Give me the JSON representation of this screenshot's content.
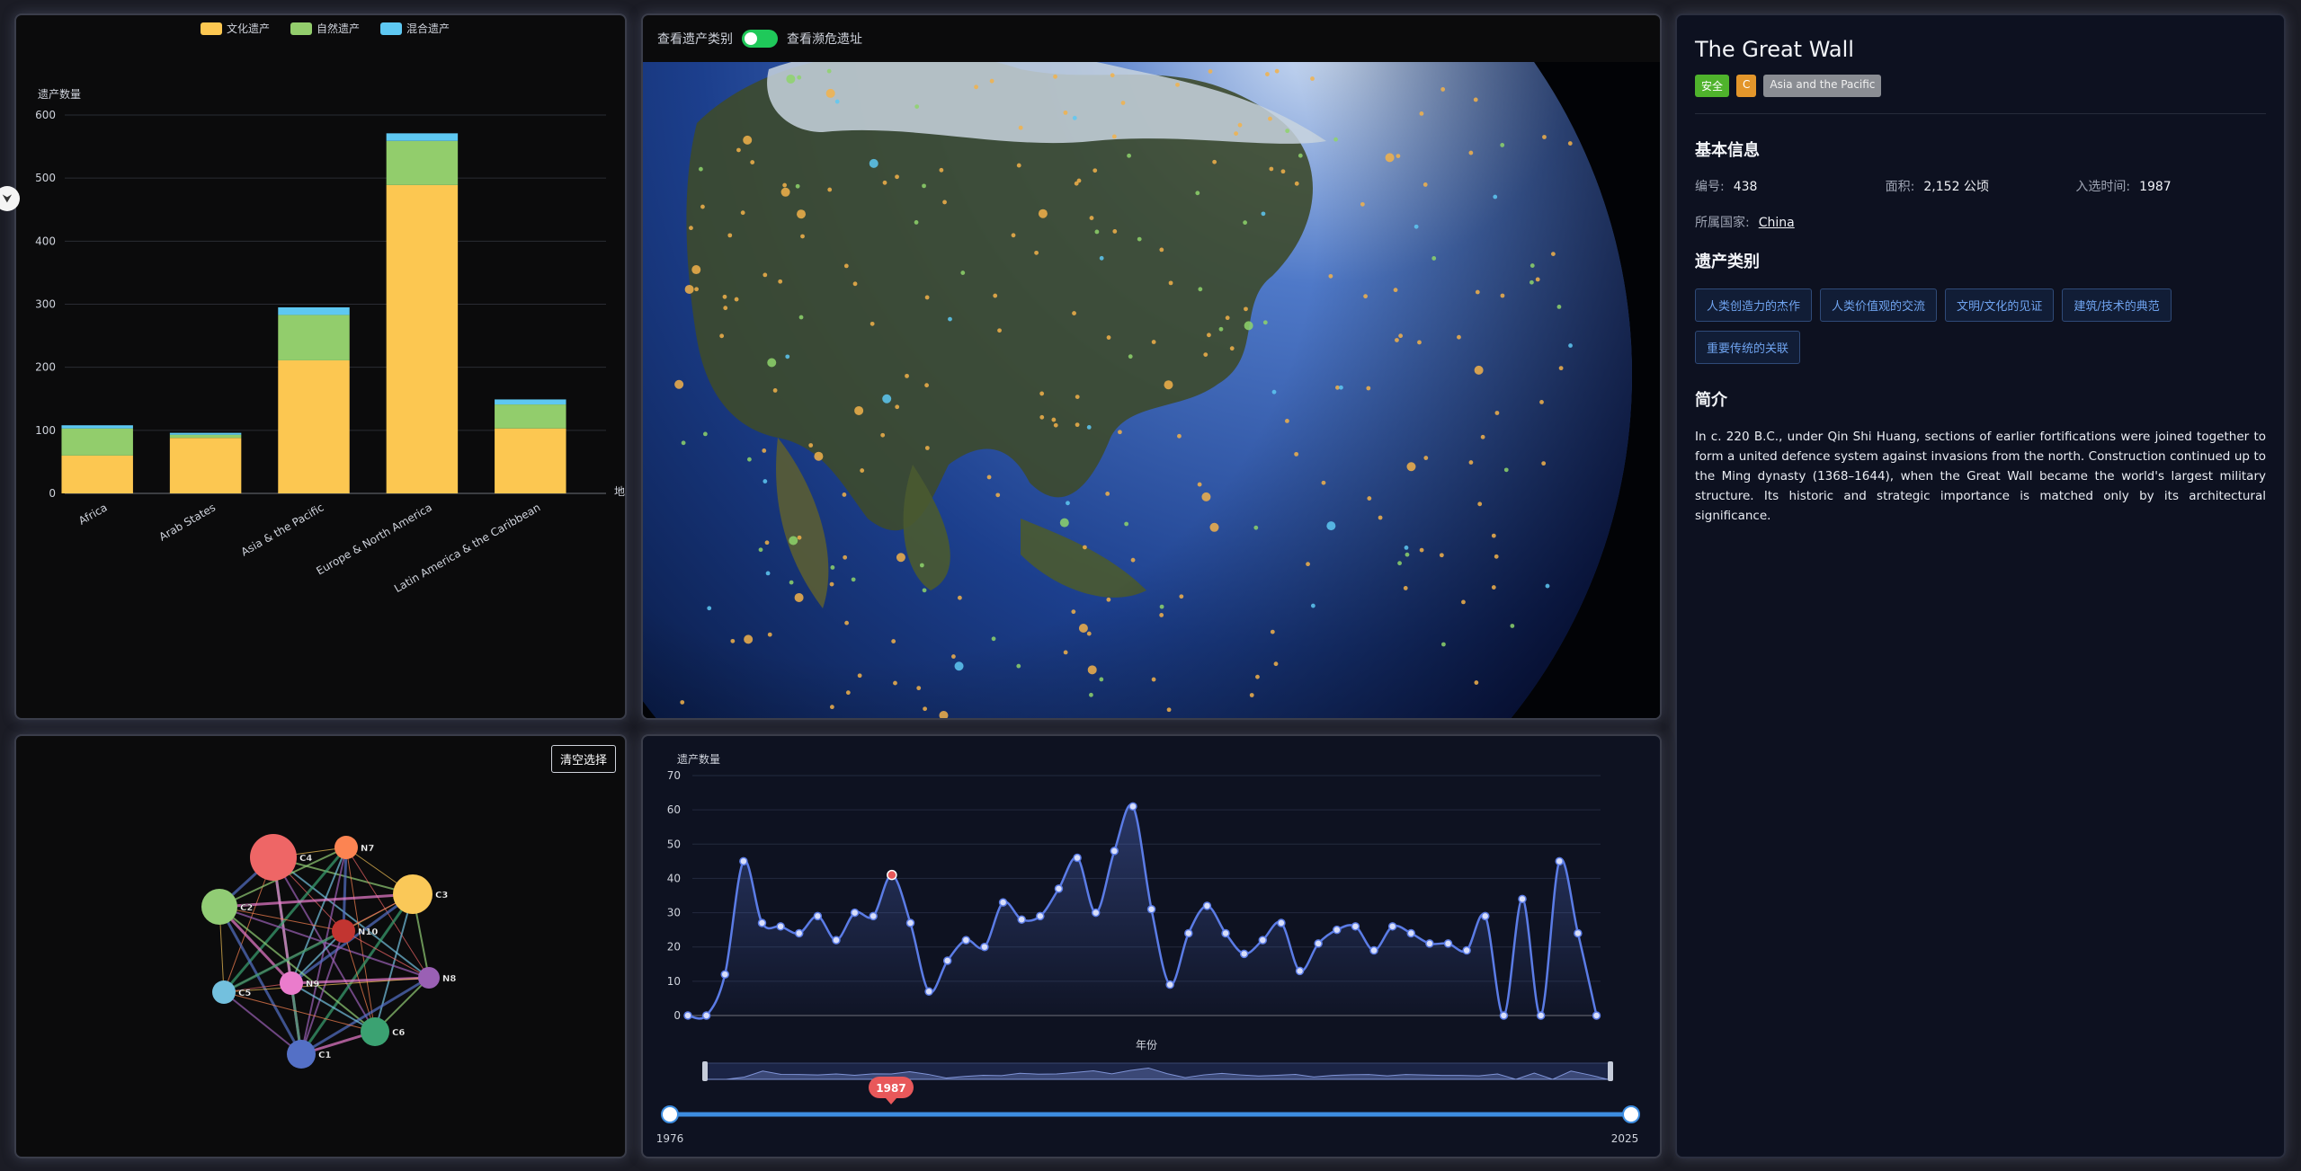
{
  "colors": {
    "cultural": "#fcc751",
    "natural": "#92cd6c",
    "mixed": "#5ec8f2",
    "line": "#5b7ce6",
    "highlight": "#e8585a",
    "slider": "#3d8de0"
  },
  "bar_panel": {
    "legend": [
      "文化遗产",
      "自然遗产",
      "混合遗产"
    ],
    "ylabel": "遗产数量",
    "x_axis_name": "地",
    "chart_data": {
      "type": "bar",
      "stacked": true,
      "categories": [
        "Africa",
        "Arab States",
        "Asia & the Pacific",
        "Europe & North America",
        "Latin America & the Caribbean"
      ],
      "series": [
        {
          "name": "文化遗产",
          "values": [
            60,
            88,
            211,
            489,
            103
          ]
        },
        {
          "name": "自然遗产",
          "values": [
            43,
            5,
            72,
            70,
            38
          ]
        },
        {
          "name": "混合遗产",
          "values": [
            5,
            3,
            12,
            12,
            8
          ]
        }
      ],
      "ylim": [
        0,
        600
      ],
      "yticks": [
        0,
        100,
        200,
        300,
        400,
        500,
        600
      ],
      "grid": true,
      "legend_position": "top"
    }
  },
  "globe_panel": {
    "label_left": "查看遗产类别",
    "label_right": "查看濒危遗址",
    "toggle_on": true
  },
  "info_panel": {
    "title": "The Great Wall",
    "tags": [
      "安全",
      "C",
      "Asia and the Pacific"
    ],
    "basic_heading": "基本信息",
    "id_label": "编号:",
    "id_value": "438",
    "area_label": "面积:",
    "area_value": "2,152 公顷",
    "year_label": "入选时间:",
    "year_value": "1987",
    "country_label": "所属国家:",
    "country_value": "China",
    "category_heading": "遗产类别",
    "categories": [
      "人类创造力的杰作",
      "人类价值观的交流",
      "文明/文化的见证",
      "建筑/技术的典范",
      "重要传统的关联"
    ],
    "intro_heading": "简介",
    "description": "In c. 220 B.C., under Qin Shi Huang, sections of earlier fortifications were joined together to form a united defence system against invasions from the north. Construction continued up to the Ming dynasty (1368–1644), when the Great Wall became the world's largest military structure. Its historic and strategic importance is matched only by its architectural significance."
  },
  "graph_panel": {
    "clear_button": "清空选择",
    "nodes": [
      {
        "id": "C4",
        "label": "C4",
        "color": "#ee6666",
        "size": 26
      },
      {
        "id": "N7",
        "label": "N7",
        "color": "#fc8452",
        "size": 13
      },
      {
        "id": "C3",
        "label": "C3",
        "color": "#fac858",
        "size": 22
      },
      {
        "id": "C2",
        "label": "C2",
        "color": "#91cc75",
        "size": 20
      },
      {
        "id": "N10",
        "label": "N10",
        "color": "#c23531",
        "size": 13
      },
      {
        "id": "N8",
        "label": "N8",
        "color": "#9a60b4",
        "size": 12
      },
      {
        "id": "N9",
        "label": "N9",
        "color": "#ea7ccc",
        "size": 13
      },
      {
        "id": "C5",
        "label": "C5",
        "color": "#73c0de",
        "size": 13
      },
      {
        "id": "C6",
        "label": "C6",
        "color": "#3ba272",
        "size": 16
      },
      {
        "id": "C1",
        "label": "C1",
        "color": "#5470c6",
        "size": 16
      }
    ]
  },
  "line_panel": {
    "ylabel": "遗产数量",
    "xlabel": "年份",
    "highlight_year": "1987",
    "range_start": "1976",
    "range_end": "2025",
    "chart_data": {
      "type": "line",
      "x": [
        1976,
        1977,
        1978,
        1979,
        1980,
        1981,
        1982,
        1983,
        1984,
        1985,
        1986,
        1987,
        1988,
        1989,
        1990,
        1991,
        1992,
        1993,
        1994,
        1995,
        1996,
        1997,
        1998,
        1999,
        2000,
        2001,
        2002,
        2003,
        2004,
        2005,
        2006,
        2007,
        2008,
        2009,
        2010,
        2011,
        2012,
        2013,
        2014,
        2015,
        2016,
        2017,
        2018,
        2019,
        2020,
        2021,
        2022,
        2023,
        2024,
        2025
      ],
      "values": [
        0,
        0,
        12,
        45,
        27,
        26,
        24,
        29,
        22,
        30,
        29,
        41,
        27,
        7,
        16,
        22,
        20,
        33,
        28,
        29,
        37,
        46,
        30,
        48,
        61,
        31,
        9,
        24,
        32,
        24,
        18,
        22,
        27,
        13,
        21,
        25,
        26,
        19,
        26,
        24,
        21,
        21,
        19,
        29,
        0,
        34,
        0,
        45,
        24,
        0
      ],
      "ylim": [
        0,
        70
      ],
      "yticks": [
        0,
        10,
        20,
        30,
        40,
        50,
        60,
        70
      ],
      "highlight": 1987,
      "grid": true
    }
  }
}
